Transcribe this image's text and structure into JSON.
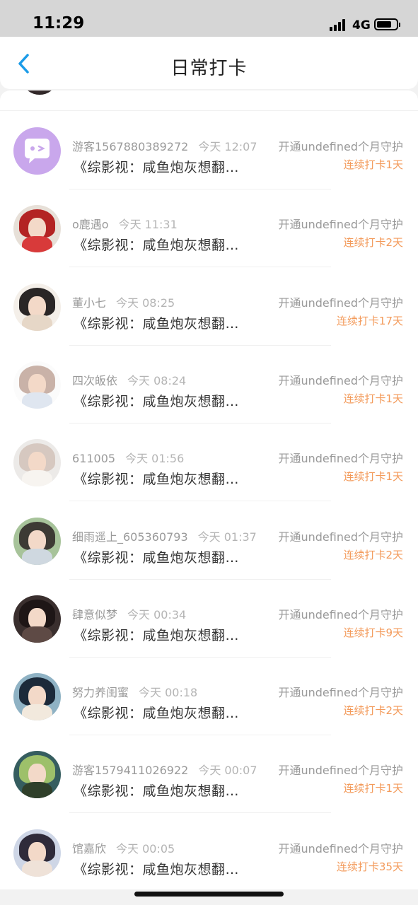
{
  "status_bar": {
    "time": "11:29",
    "network": "4G",
    "battery_level": 0.75
  },
  "header": {
    "title": "日常打卡",
    "back_icon": "chevron-left-icon"
  },
  "entries": [
    {
      "name": "游客1567880389272",
      "time": "今天 12:07",
      "title": "《综影视：咸鱼炮灰想翻…",
      "guard": "开通undefined个月守护",
      "streak": "连续打卡1天",
      "avatar": "chat-bubble-icon"
    },
    {
      "name": "o鹿遇o",
      "time": "今天 11:31",
      "title": "《综影视：咸鱼炮灰想翻…",
      "guard": "开通undefined个月守护",
      "streak": "连续打卡2天",
      "avatar": "user-photo"
    },
    {
      "name": "董小七",
      "time": "今天 08:25",
      "title": "《综影视：咸鱼炮灰想翻…",
      "guard": "开通undefined个月守护",
      "streak": "连续打卡17天",
      "avatar": "user-photo"
    },
    {
      "name": "四次皈依",
      "time": "今天 08:24",
      "title": "《综影视：咸鱼炮灰想翻…",
      "guard": "开通undefined个月守护",
      "streak": "连续打卡1天",
      "avatar": "user-photo"
    },
    {
      "name": "611005",
      "time": "今天 01:56",
      "title": "《综影视：咸鱼炮灰想翻…",
      "guard": "开通undefined个月守护",
      "streak": "连续打卡1天",
      "avatar": "user-photo"
    },
    {
      "name": "细雨遥上_605360793",
      "time": "今天 01:37",
      "title": "《综影视：咸鱼炮灰想翻…",
      "guard": "开通undefined个月守护",
      "streak": "连续打卡2天",
      "avatar": "user-photo"
    },
    {
      "name": "肆意似梦",
      "time": "今天 00:34",
      "title": "《综影视：咸鱼炮灰想翻…",
      "guard": "开通undefined个月守护",
      "streak": "连续打卡9天",
      "avatar": "user-photo"
    },
    {
      "name": "努力养闺蜜",
      "time": "今天 00:18",
      "title": "《综影视：咸鱼炮灰想翻…",
      "guard": "开通undefined个月守护",
      "streak": "连续打卡2天",
      "avatar": "user-photo"
    },
    {
      "name": "游客1579411026922",
      "time": "今天 00:07",
      "title": "《综影视：咸鱼炮灰想翻…",
      "guard": "开通undefined个月守护",
      "streak": "连续打卡1天",
      "avatar": "user-photo"
    },
    {
      "name": "馆嘉欣",
      "time": "今天 00:05",
      "title": "《综影视：咸鱼炮灰想翻…",
      "guard": "开通undefined个月守护",
      "streak": "连续打卡35天",
      "avatar": "user-photo"
    }
  ],
  "colors": {
    "accent": "#1a9be8",
    "streak": "#f39a5a",
    "muted": "#9a9a9a"
  }
}
